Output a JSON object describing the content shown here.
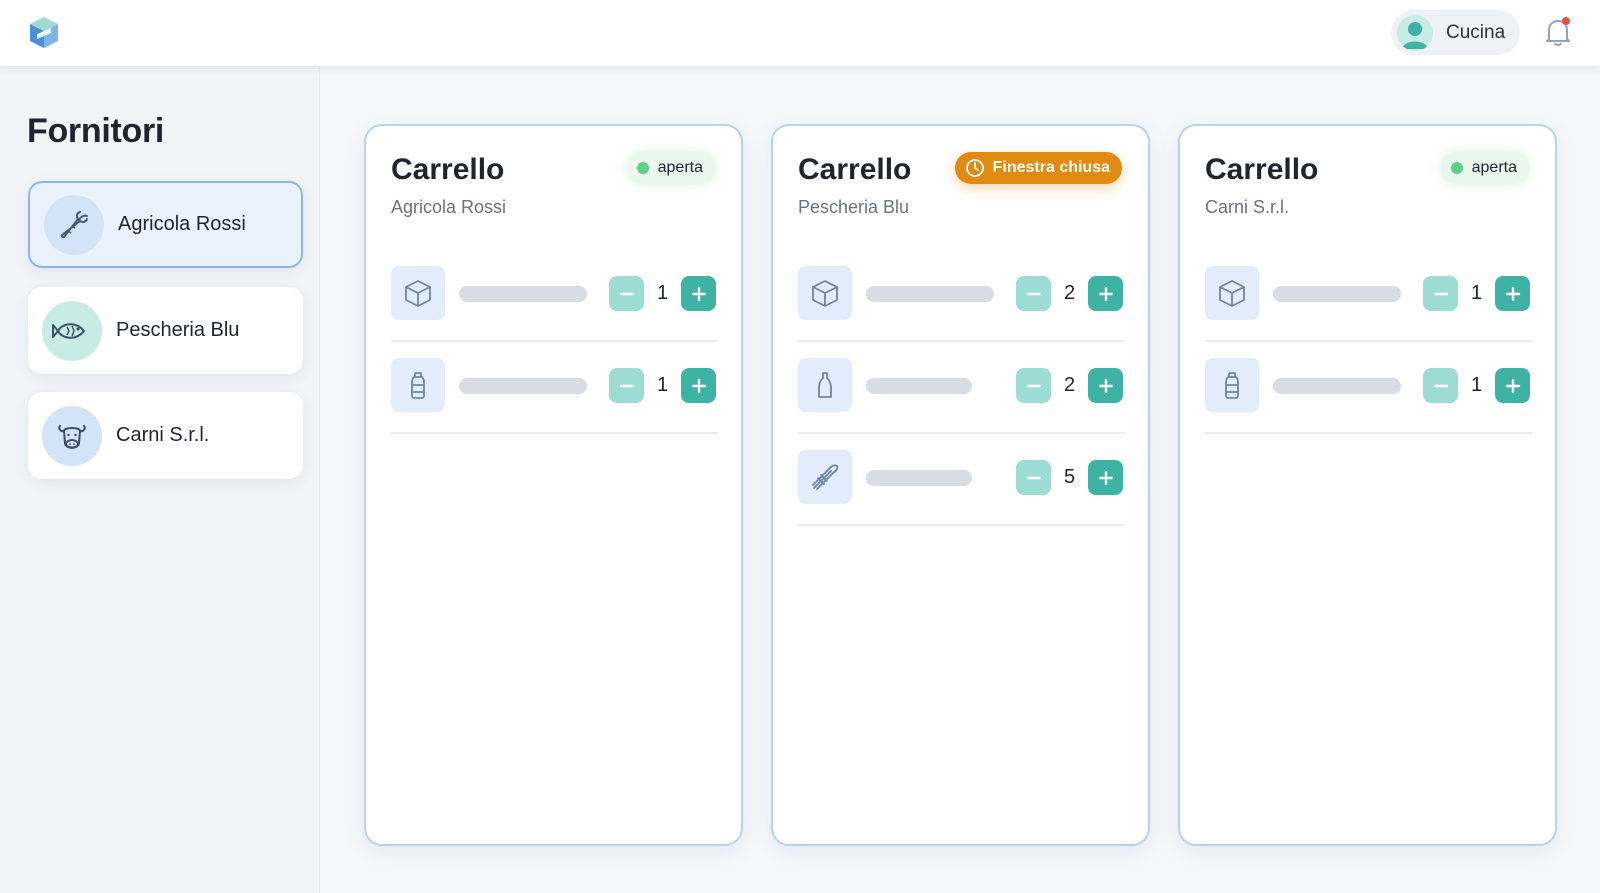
{
  "header": {
    "user_name": "Cucina"
  },
  "sidebar": {
    "title": "Fornitori",
    "suppliers": [
      {
        "label": "Agricola Rossi",
        "icon": "carrot-icon",
        "active": true
      },
      {
        "label": "Pescheria Blu",
        "icon": "fish-icon",
        "active": false
      },
      {
        "label": "Carni S.r.l.",
        "icon": "cow-icon",
        "active": false
      }
    ]
  },
  "carts": [
    {
      "title": "Carrello",
      "supplier": "Agricola Rossi",
      "status": "aperta",
      "status_type": "open",
      "items": [
        {
          "icon": "box-icon",
          "qty": "1"
        },
        {
          "icon": "bottle-icon",
          "qty": "1"
        }
      ]
    },
    {
      "title": "Carrello",
      "supplier": "Pescheria Blu",
      "status": "Finestra chiusa",
      "status_type": "closed",
      "items": [
        {
          "icon": "box-icon",
          "qty": "2"
        },
        {
          "icon": "bottle-icon",
          "qty": "2"
        },
        {
          "icon": "asparagus-icon",
          "qty": "5"
        }
      ]
    },
    {
      "title": "Carrello",
      "supplier": "Carni S.r.l.",
      "status": "aperta",
      "status_type": "open",
      "items": [
        {
          "icon": "box-icon",
          "qty": "1"
        },
        {
          "icon": "bottle-icon",
          "qty": "1"
        }
      ]
    }
  ],
  "colors": {
    "accent_teal": "#3fb3a3",
    "teal_light": "#9ddcd4",
    "closed_orange": "#e08a12",
    "open_green": "#5fd08a",
    "card_border": "#b9d2f0"
  }
}
